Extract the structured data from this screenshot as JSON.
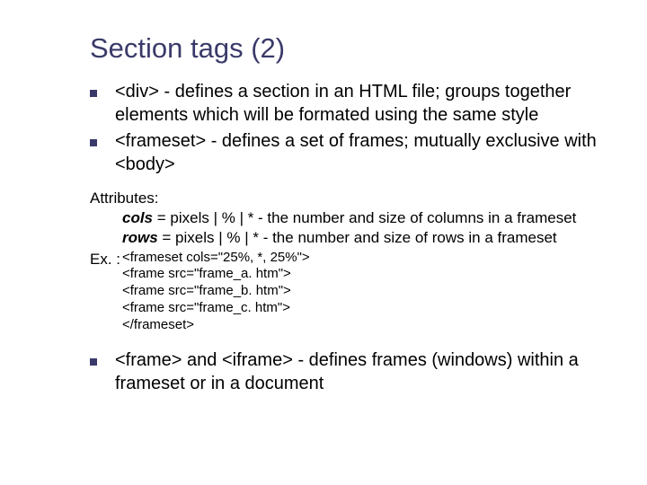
{
  "title": "Section tags (2)",
  "bullets": [
    "<div> - defines a section in an HTML file; groups together elements which will be formated using the same style",
    "<frameset> - defines a set of frames; mutually exclusive with <body>"
  ],
  "attributes": {
    "heading": "Attributes:",
    "lines": [
      {
        "name": "cols",
        "rest": " = pixels | % | *  - the number and size of columns in a frameset"
      },
      {
        "name": "rows",
        "rest": " = pixels | % | *  - the number and size of rows in a frameset"
      }
    ]
  },
  "example": {
    "label": "Ex. :",
    "code": "<frameset cols=\"25%, *, 25%\">\n<frame src=\"frame_a. htm\">\n<frame src=\"frame_b. htm\">\n<frame src=\"frame_c. htm\">\n</frameset>"
  },
  "bullets2": [
    "<frame> and <iframe> - defines frames (windows) within a frameset or in a document"
  ]
}
